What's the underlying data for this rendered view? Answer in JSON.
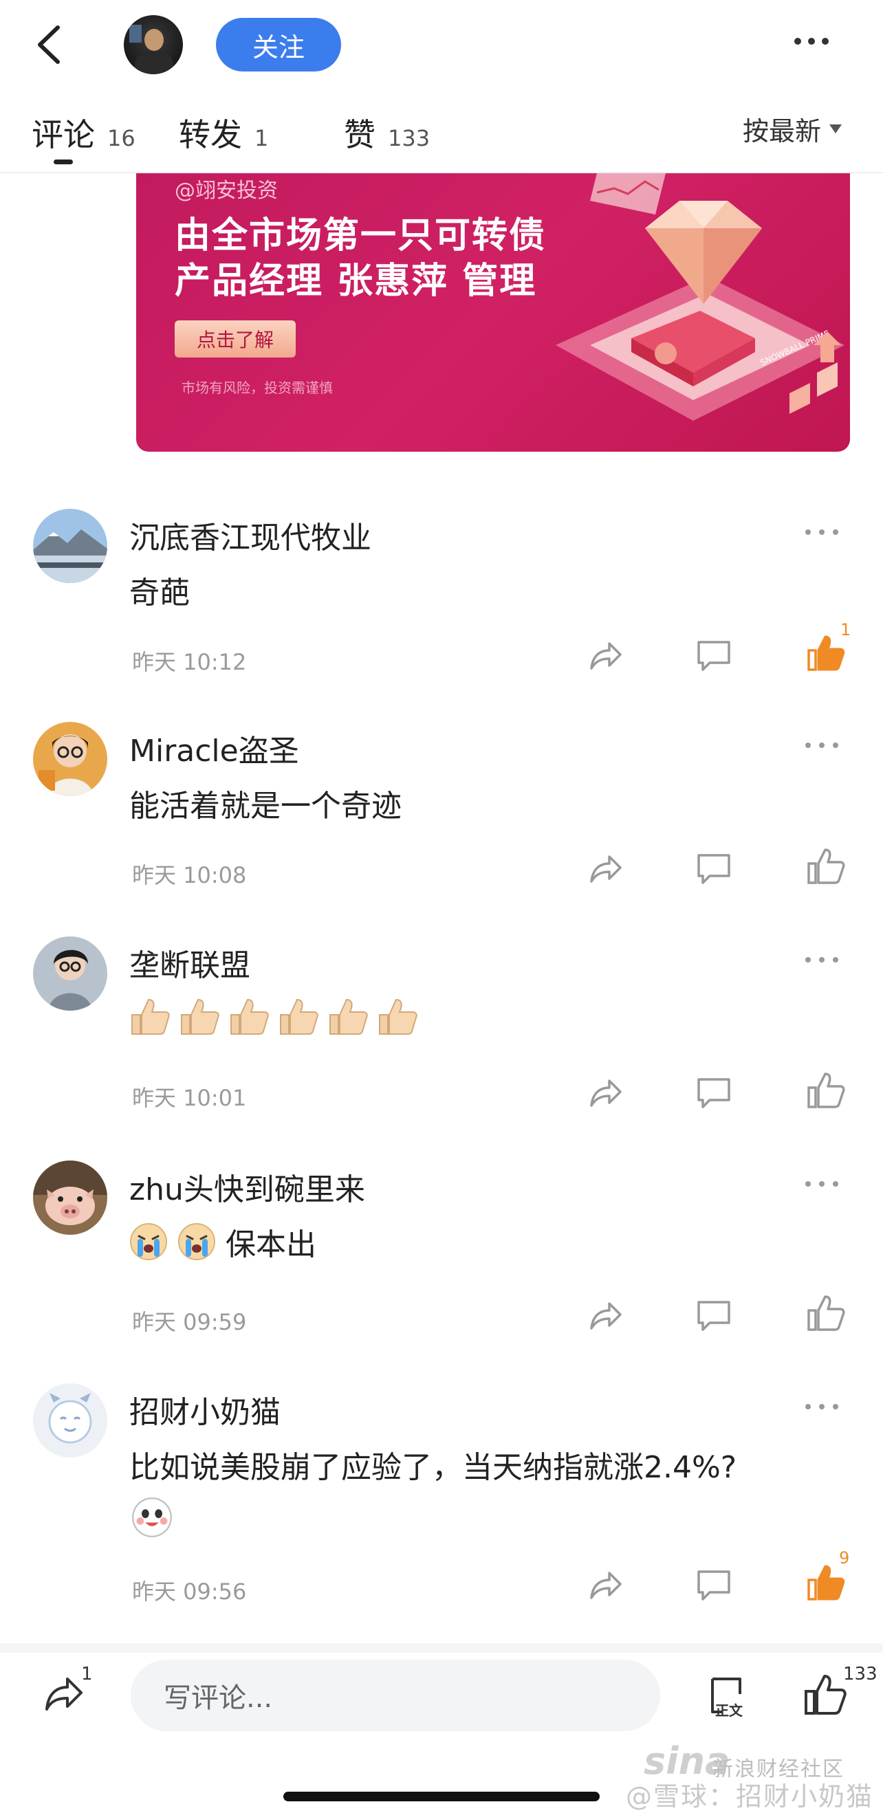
{
  "header": {
    "follow_label": "关注"
  },
  "tabs": [
    {
      "label": "评论",
      "count": "16"
    },
    {
      "label": "转发",
      "count": "1"
    },
    {
      "label": "赞",
      "count": "133"
    }
  ],
  "sort_label": "按最新",
  "banner": {
    "handle": "@翊安投资",
    "line1": "由全市场第一只可转债",
    "line2": "产品经理 张惠萍 管理",
    "cta": "点击了解",
    "risk": "市场有风险，投资需谨慎",
    "badge_text": "SNOWBALL PRIME"
  },
  "comments": [
    {
      "name": "沉底香江现代牧业",
      "text": "奇葩",
      "time": "昨天 10:12",
      "likes": "1",
      "liked": true
    },
    {
      "name": "Miracle盗圣",
      "text": "能活着就是一个奇迹",
      "time": "昨天 10:08",
      "likes": "",
      "liked": false
    },
    {
      "name": "垄断联盟",
      "text": "",
      "time": "昨天 10:01",
      "likes": "",
      "liked": false,
      "emoji": "thumbs-up-x6"
    },
    {
      "name": "zhu头快到碗里来",
      "text": "保本出",
      "time": "昨天 09:59",
      "likes": "",
      "liked": false,
      "emoji": "crying-x2"
    },
    {
      "name": "招财小奶猫",
      "text": "比如说美股崩了应验了，当天纳指就涨2.4%?",
      "time": "昨天 09:56",
      "likes": "9",
      "liked": true,
      "emoji": "smile"
    }
  ],
  "bottom": {
    "share_count": "1",
    "input_placeholder": "写评论...",
    "doc_label": "正文",
    "like_count": "133"
  },
  "watermark": {
    "logo": "sina",
    "line1": "新浪财经社区",
    "line2": "@雪球：招财小奶猫"
  },
  "colors": {
    "accent_blue": "#3b7ded",
    "like_orange": "#f08a24",
    "banner_red": "#c8195c"
  }
}
